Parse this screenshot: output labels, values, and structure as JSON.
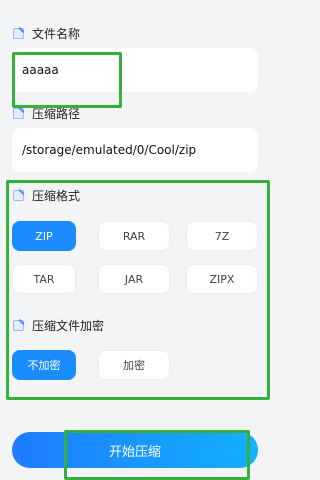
{
  "file_name": {
    "label": "文件名称",
    "value": "aaaaa"
  },
  "compress_path": {
    "label": "压缩路径",
    "value": "/storage/emulated/0/Cool/zip"
  },
  "compress_format": {
    "label": "压缩格式",
    "options": [
      "ZIP",
      "RAR",
      "7Z",
      "TAR",
      "JAR",
      "ZIPX"
    ],
    "selected": "ZIP"
  },
  "encryption": {
    "label": "压缩文件加密",
    "options": [
      "不加密",
      "加密"
    ],
    "selected": "不加密"
  },
  "start_button_label": "开始压缩",
  "colors": {
    "accent": "#1a8cff",
    "highlight": "#33b13a",
    "background": "#f3f4f6"
  }
}
